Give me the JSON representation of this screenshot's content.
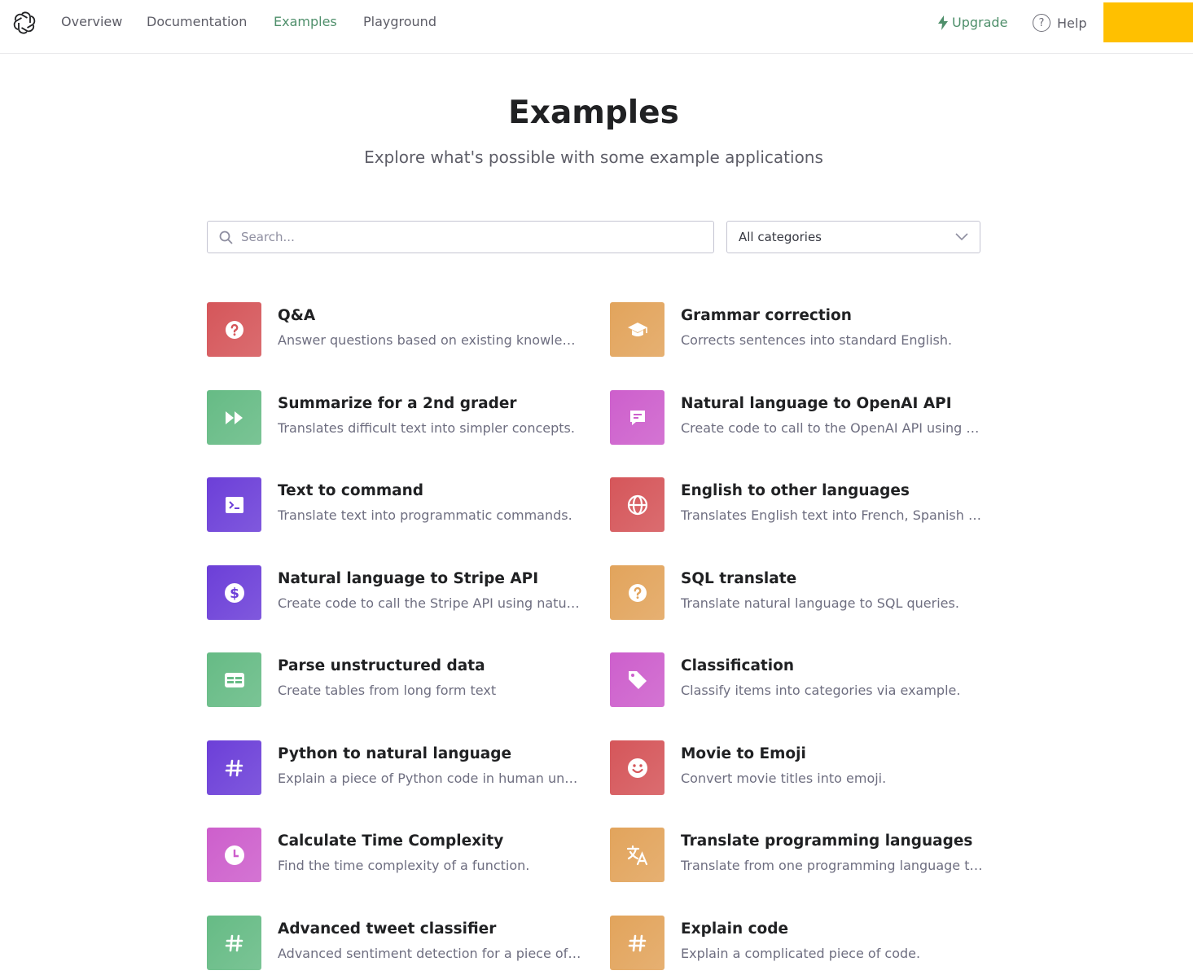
{
  "nav": {
    "links": [
      "Overview",
      "Documentation",
      "Examples",
      "Playground"
    ],
    "active": "Examples",
    "upgrade_label": "Upgrade",
    "help_label": "Help",
    "accent_color": "#4f8f6b",
    "account_block_color": "#ffc000"
  },
  "header": {
    "title": "Examples",
    "subtitle": "Explore what's possible with some example applications"
  },
  "filters": {
    "search_placeholder": "Search...",
    "category_selected": "All categories"
  },
  "examples": [
    {
      "title": "Q&A",
      "description": "Answer questions based on existing knowledge.",
      "icon": "question-icon",
      "color": "#d5565a"
    },
    {
      "title": "Grammar correction",
      "description": "Corrects sentences into standard English.",
      "icon": "graduation-cap-icon",
      "color": "#e2a45c"
    },
    {
      "title": "Summarize for a 2nd grader",
      "description": "Translates difficult text into simpler concepts.",
      "icon": "fast-forward-icon",
      "color": "#66bb85"
    },
    {
      "title": "Natural language to OpenAI API",
      "description": "Create code to call to the OpenAI API using a natural language instruction.",
      "icon": "message-icon",
      "color": "#cd5fcc"
    },
    {
      "title": "Text to command",
      "description": "Translate text into programmatic commands.",
      "icon": "terminal-icon",
      "color": "#6c3fd8"
    },
    {
      "title": "English to other languages",
      "description": "Translates English text into French, Spanish and Japanese.",
      "icon": "globe-icon",
      "color": "#d5565a"
    },
    {
      "title": "Natural language to Stripe API",
      "description": "Create code to call the Stripe API using natural language.",
      "icon": "dollar-icon",
      "color": "#6c3fd8"
    },
    {
      "title": "SQL translate",
      "description": "Translate natural language to SQL queries.",
      "icon": "question-icon",
      "color": "#e2a45c"
    },
    {
      "title": "Parse unstructured data",
      "description": "Create tables from long form text",
      "icon": "table-icon",
      "color": "#66bb85"
    },
    {
      "title": "Classification",
      "description": "Classify items into categories via example.",
      "icon": "tag-icon",
      "color": "#cd5fcc"
    },
    {
      "title": "Python to natural language",
      "description": "Explain a piece of Python code in human understandable language.",
      "icon": "hash-icon",
      "color": "#6c3fd8"
    },
    {
      "title": "Movie to Emoji",
      "description": "Convert movie titles into emoji.",
      "icon": "smile-icon",
      "color": "#d5565a"
    },
    {
      "title": "Calculate Time Complexity",
      "description": "Find the time complexity of a function.",
      "icon": "clock-icon",
      "color": "#cd5fcc"
    },
    {
      "title": "Translate programming languages",
      "description": "Translate from one programming language to another.",
      "icon": "translate-icon",
      "color": "#e2a45c"
    },
    {
      "title": "Advanced tweet classifier",
      "description": "Advanced sentiment detection for a piece of text.",
      "icon": "hash-icon",
      "color": "#66bb85"
    },
    {
      "title": "Explain code",
      "description": "Explain a complicated piece of code.",
      "icon": "hash-icon",
      "color": "#e2a45c"
    }
  ]
}
